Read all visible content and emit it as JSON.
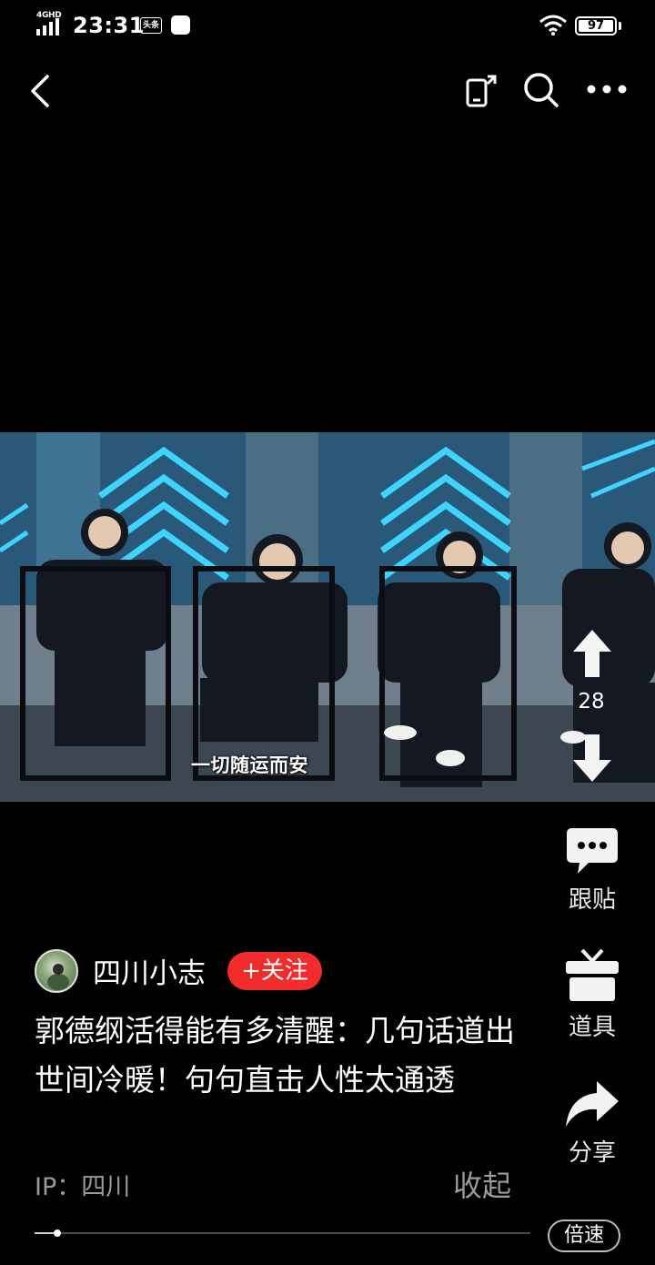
{
  "status_bar": {
    "network": "4GHD",
    "time": "23:31",
    "app_badge": "头条",
    "battery": "97"
  },
  "video": {
    "caption": "一切随运而安"
  },
  "vote": {
    "count": "28"
  },
  "actions": {
    "reply_label": "跟贴",
    "props_label": "道具",
    "share_label": "分享"
  },
  "author": {
    "name": "四川小志",
    "follow_label": "+关注"
  },
  "post": {
    "title": "郭德纲活得能有多清醒：几句话道出世间冷暖！句句直击人性太通透",
    "ip_label": "IP：四川",
    "collapse_label": "收起"
  },
  "player": {
    "progress": 0.045,
    "speed_label": "倍速"
  },
  "colors": {
    "follow_red": "#f02c2c",
    "background": "#000000"
  }
}
